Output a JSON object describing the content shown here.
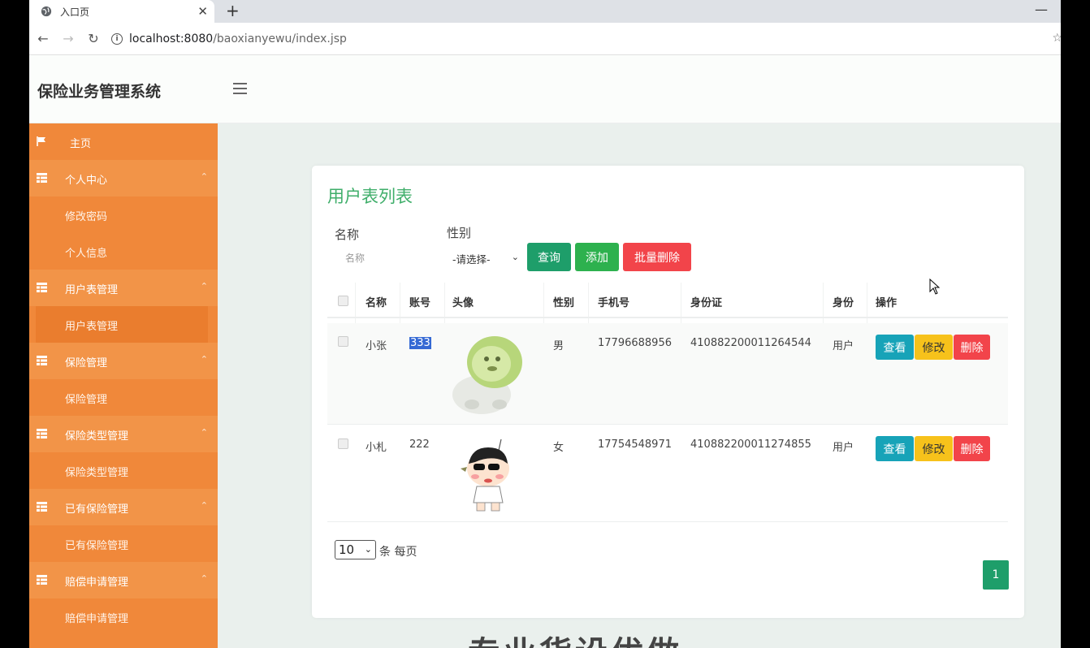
{
  "browser": {
    "tab_title": "入口页",
    "url_host": "localhost:8080",
    "url_path": "/baoxianyewu/index.jsp"
  },
  "app": {
    "title": "保险业务管理系统"
  },
  "sidebar": {
    "items": [
      {
        "label": "主页",
        "type": "home"
      },
      {
        "label": "个人中心",
        "type": "parent"
      },
      {
        "label": "修改密码",
        "type": "sub"
      },
      {
        "label": "个人信息",
        "type": "sub"
      },
      {
        "label": "用户表管理",
        "type": "parent"
      },
      {
        "label": "用户表管理",
        "type": "sub-active"
      },
      {
        "label": "保险管理",
        "type": "parent"
      },
      {
        "label": "保险管理",
        "type": "sub"
      },
      {
        "label": "保险类型管理",
        "type": "parent"
      },
      {
        "label": "保险类型管理",
        "type": "sub"
      },
      {
        "label": "已有保险管理",
        "type": "parent"
      },
      {
        "label": "已有保险管理",
        "type": "sub"
      },
      {
        "label": "赔偿申请管理",
        "type": "parent"
      },
      {
        "label": "赔偿申请管理",
        "type": "sub"
      }
    ]
  },
  "main": {
    "card_title": "用户表列表",
    "filter": {
      "name_label": "名称",
      "name_placeholder": "名称",
      "gender_label": "性别",
      "gender_selected": "-请选择-",
      "query_label": "查询",
      "add_label": "添加",
      "batch_delete_label": "批量删除"
    },
    "table": {
      "headers": [
        "名称",
        "账号",
        "头像",
        "性别",
        "手机号",
        "身份证",
        "身份",
        "操作"
      ],
      "rows": [
        {
          "name": "小张",
          "account": "333",
          "gender": "男",
          "phone": "17796688956",
          "id_card": "410882200011264544",
          "role": "用户"
        },
        {
          "name": "小札",
          "account": "222",
          "gender": "女",
          "phone": "17754548971",
          "id_card": "410882200011274855",
          "role": "用户"
        }
      ],
      "actions": {
        "view": "查看",
        "edit": "修改",
        "delete": "删除"
      }
    },
    "pagination": {
      "page_size": "10",
      "per_page_text": "条 每页",
      "current_page": "1"
    },
    "footer_text": "专业货设优做"
  },
  "colors": {
    "sidebar": "#f0883a",
    "title_green": "#3fae6a",
    "query_btn": "#1e9e6a",
    "add_btn": "#2db14e",
    "delete_btn": "#f2444a",
    "view_btn": "#17a3b8",
    "edit_btn": "#f7c21b"
  }
}
